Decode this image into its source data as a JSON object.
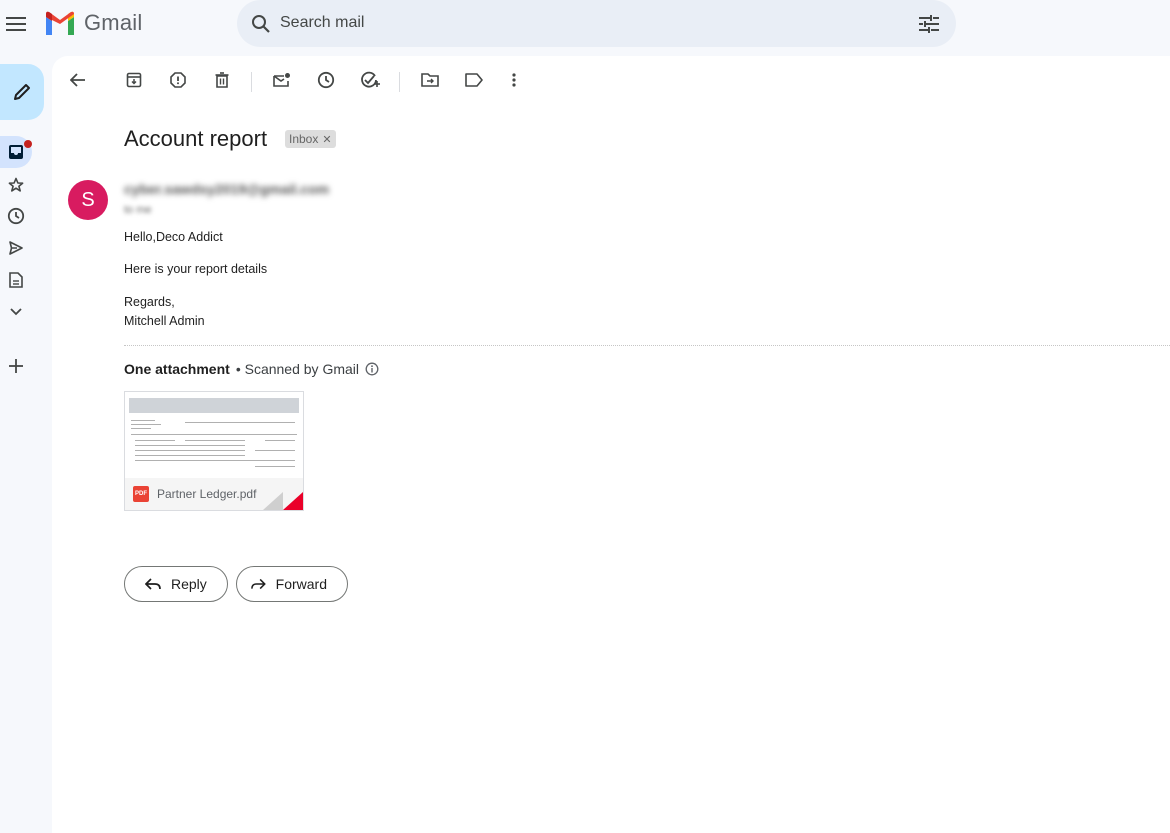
{
  "app": {
    "name": "Gmail"
  },
  "search": {
    "placeholder": "Search mail"
  },
  "email": {
    "subject": "Account report",
    "label": "Inbox",
    "sender_initial": "S",
    "sender_email": "cyber.sawdsy2019@gmail.com",
    "to_line": "to me",
    "body": {
      "greeting": "Hello,Deco Addict",
      "line1": "Here is your report details",
      "closing": "Regards,",
      "signature": "Mitchell Admin"
    }
  },
  "attachments": {
    "heading": "One attachment",
    "scanned": "• Scanned by Gmail",
    "file": {
      "name": "Partner Ledger.pdf",
      "type_badge": "PDF"
    }
  },
  "actions": {
    "reply": "Reply",
    "forward": "Forward"
  },
  "colors": {
    "avatar": "#d81b60",
    "compose": "#c2e7ff",
    "pdf": "#ea4335"
  }
}
